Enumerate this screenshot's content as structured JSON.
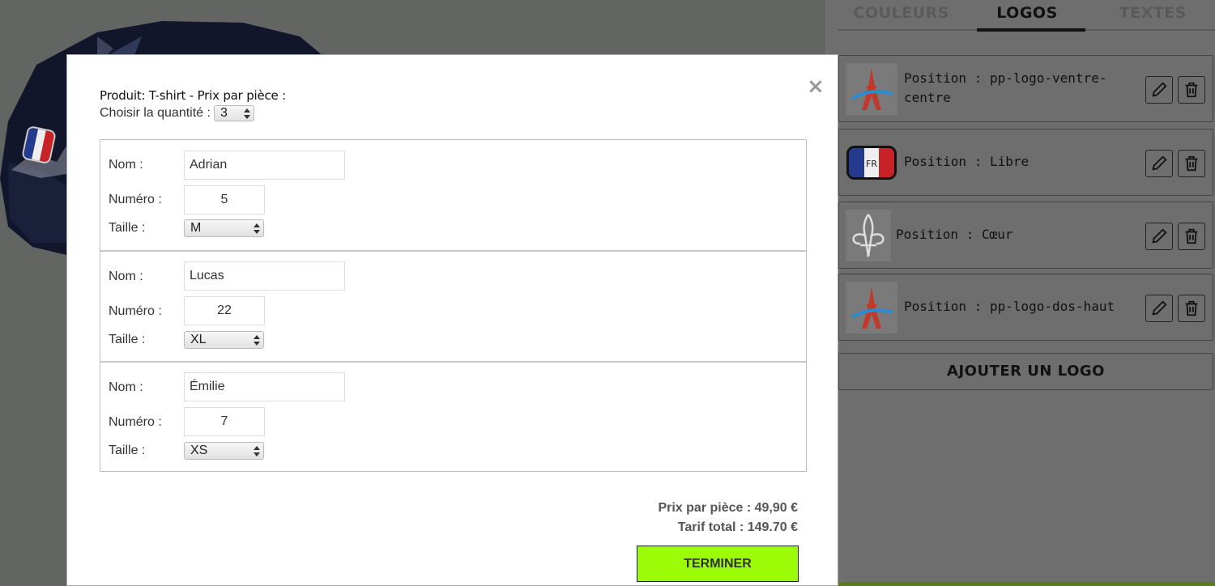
{
  "tabs": [
    {
      "label": "COULEURS",
      "active": false
    },
    {
      "label": "LOGOS",
      "active": true
    },
    {
      "label": "TEXTES",
      "active": false
    }
  ],
  "logos": [
    {
      "position": "Position : pp-logo-ventre-\ncentre",
      "icon": "eiffel-logo-icon"
    },
    {
      "position": "Position : Libre",
      "icon": "france-flag-icon"
    },
    {
      "position": "Position : Cœur",
      "icon": "fleur-de-lis-icon"
    },
    {
      "position": "Position : pp-logo-dos-haut",
      "icon": "eiffel-logo-icon"
    }
  ],
  "flag_text": "FR",
  "add_logo_label": "AJOUTER UN LOGO",
  "modal": {
    "close": "×",
    "product_label": "Produit: T-shirt - Prix par pièce :",
    "quantity_label": "Choisir la quantité :",
    "quantity_value": "3",
    "players": [
      {
        "name_label": "Nom :",
        "name": "Adrian",
        "number_label": "Numéro :",
        "number": "5",
        "size_label": "Taille :",
        "size": "M"
      },
      {
        "name_label": "Nom :",
        "name": "Lucas",
        "number_label": "Numéro :",
        "number": "22",
        "size_label": "Taille :",
        "size": "XL"
      },
      {
        "name_label": "Nom :",
        "name": "Émilie",
        "number_label": "Numéro :",
        "number": "7",
        "size_label": "Taille :",
        "size": "XS"
      }
    ],
    "price_each": "Prix par pièce : 49,90 €",
    "price_total": "Tarif total : 149.70 €",
    "finish_label": "TERMINER"
  },
  "colors": {
    "finish_button": "#9cfb06",
    "shirt_navy": "#12162b",
    "overlay": "#666666"
  }
}
